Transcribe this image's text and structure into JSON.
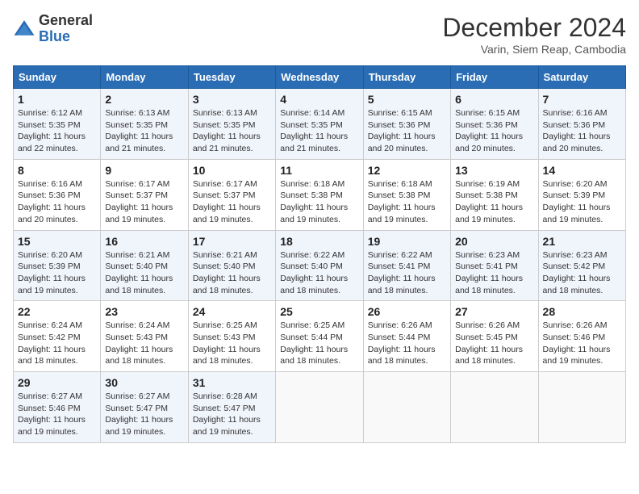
{
  "header": {
    "logo_general": "General",
    "logo_blue": "Blue",
    "month_title": "December 2024",
    "subtitle": "Varin, Siem Reap, Cambodia"
  },
  "days_of_week": [
    "Sunday",
    "Monday",
    "Tuesday",
    "Wednesday",
    "Thursday",
    "Friday",
    "Saturday"
  ],
  "weeks": [
    [
      {
        "day": "1",
        "info": "Sunrise: 6:12 AM\nSunset: 5:35 PM\nDaylight: 11 hours and 22 minutes."
      },
      {
        "day": "2",
        "info": "Sunrise: 6:13 AM\nSunset: 5:35 PM\nDaylight: 11 hours and 21 minutes."
      },
      {
        "day": "3",
        "info": "Sunrise: 6:13 AM\nSunset: 5:35 PM\nDaylight: 11 hours and 21 minutes."
      },
      {
        "day": "4",
        "info": "Sunrise: 6:14 AM\nSunset: 5:35 PM\nDaylight: 11 hours and 21 minutes."
      },
      {
        "day": "5",
        "info": "Sunrise: 6:15 AM\nSunset: 5:36 PM\nDaylight: 11 hours and 20 minutes."
      },
      {
        "day": "6",
        "info": "Sunrise: 6:15 AM\nSunset: 5:36 PM\nDaylight: 11 hours and 20 minutes."
      },
      {
        "day": "7",
        "info": "Sunrise: 6:16 AM\nSunset: 5:36 PM\nDaylight: 11 hours and 20 minutes."
      }
    ],
    [
      {
        "day": "8",
        "info": "Sunrise: 6:16 AM\nSunset: 5:36 PM\nDaylight: 11 hours and 20 minutes."
      },
      {
        "day": "9",
        "info": "Sunrise: 6:17 AM\nSunset: 5:37 PM\nDaylight: 11 hours and 19 minutes."
      },
      {
        "day": "10",
        "info": "Sunrise: 6:17 AM\nSunset: 5:37 PM\nDaylight: 11 hours and 19 minutes."
      },
      {
        "day": "11",
        "info": "Sunrise: 6:18 AM\nSunset: 5:38 PM\nDaylight: 11 hours and 19 minutes."
      },
      {
        "day": "12",
        "info": "Sunrise: 6:18 AM\nSunset: 5:38 PM\nDaylight: 11 hours and 19 minutes."
      },
      {
        "day": "13",
        "info": "Sunrise: 6:19 AM\nSunset: 5:38 PM\nDaylight: 11 hours and 19 minutes."
      },
      {
        "day": "14",
        "info": "Sunrise: 6:20 AM\nSunset: 5:39 PM\nDaylight: 11 hours and 19 minutes."
      }
    ],
    [
      {
        "day": "15",
        "info": "Sunrise: 6:20 AM\nSunset: 5:39 PM\nDaylight: 11 hours and 19 minutes."
      },
      {
        "day": "16",
        "info": "Sunrise: 6:21 AM\nSunset: 5:40 PM\nDaylight: 11 hours and 18 minutes."
      },
      {
        "day": "17",
        "info": "Sunrise: 6:21 AM\nSunset: 5:40 PM\nDaylight: 11 hours and 18 minutes."
      },
      {
        "day": "18",
        "info": "Sunrise: 6:22 AM\nSunset: 5:40 PM\nDaylight: 11 hours and 18 minutes."
      },
      {
        "day": "19",
        "info": "Sunrise: 6:22 AM\nSunset: 5:41 PM\nDaylight: 11 hours and 18 minutes."
      },
      {
        "day": "20",
        "info": "Sunrise: 6:23 AM\nSunset: 5:41 PM\nDaylight: 11 hours and 18 minutes."
      },
      {
        "day": "21",
        "info": "Sunrise: 6:23 AM\nSunset: 5:42 PM\nDaylight: 11 hours and 18 minutes."
      }
    ],
    [
      {
        "day": "22",
        "info": "Sunrise: 6:24 AM\nSunset: 5:42 PM\nDaylight: 11 hours and 18 minutes."
      },
      {
        "day": "23",
        "info": "Sunrise: 6:24 AM\nSunset: 5:43 PM\nDaylight: 11 hours and 18 minutes."
      },
      {
        "day": "24",
        "info": "Sunrise: 6:25 AM\nSunset: 5:43 PM\nDaylight: 11 hours and 18 minutes."
      },
      {
        "day": "25",
        "info": "Sunrise: 6:25 AM\nSunset: 5:44 PM\nDaylight: 11 hours and 18 minutes."
      },
      {
        "day": "26",
        "info": "Sunrise: 6:26 AM\nSunset: 5:44 PM\nDaylight: 11 hours and 18 minutes."
      },
      {
        "day": "27",
        "info": "Sunrise: 6:26 AM\nSunset: 5:45 PM\nDaylight: 11 hours and 18 minutes."
      },
      {
        "day": "28",
        "info": "Sunrise: 6:26 AM\nSunset: 5:46 PM\nDaylight: 11 hours and 19 minutes."
      }
    ],
    [
      {
        "day": "29",
        "info": "Sunrise: 6:27 AM\nSunset: 5:46 PM\nDaylight: 11 hours and 19 minutes."
      },
      {
        "day": "30",
        "info": "Sunrise: 6:27 AM\nSunset: 5:47 PM\nDaylight: 11 hours and 19 minutes."
      },
      {
        "day": "31",
        "info": "Sunrise: 6:28 AM\nSunset: 5:47 PM\nDaylight: 11 hours and 19 minutes."
      },
      null,
      null,
      null,
      null
    ]
  ]
}
